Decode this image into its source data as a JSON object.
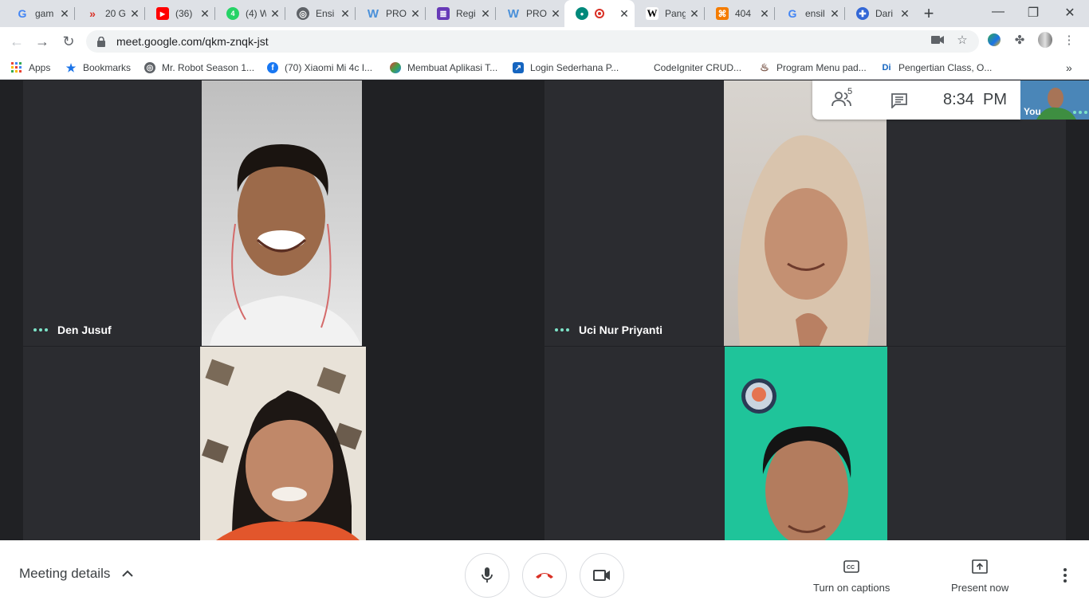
{
  "browser": {
    "tabs": [
      {
        "title": "gam",
        "favicon": "google-g-icon",
        "color": "#4285f4"
      },
      {
        "title": "20 G",
        "favicon": "chevron-logo-icon",
        "color": "#d93025"
      },
      {
        "title": "(36)",
        "favicon": "youtube-icon",
        "color": "#ff0000"
      },
      {
        "title": "(4) W",
        "favicon": "whatsapp-icon",
        "color": "#25d366"
      },
      {
        "title": "Ensi",
        "favicon": "globe-icon",
        "color": "#5f6368"
      },
      {
        "title": "PRO",
        "favicon": "word-w-icon",
        "color": "#4a90d9"
      },
      {
        "title": "Regi",
        "favicon": "forms-icon",
        "color": "#673ab7"
      },
      {
        "title": "PRO",
        "favicon": "word-w-icon",
        "color": "#4a90d9"
      },
      {
        "title": "",
        "favicon": "meet-icon",
        "color": "#00897b"
      },
      {
        "title": "Pang",
        "favicon": "wikipedia-w-icon",
        "color": "#000000"
      },
      {
        "title": "404",
        "favicon": "box-icon",
        "color": "#f57c00"
      },
      {
        "title": "ensil",
        "favicon": "google-g-icon",
        "color": "#4285f4"
      },
      {
        "title": "Dari",
        "favicon": "translate-icon",
        "color": "#3367d6"
      }
    ],
    "url": "meet.google.com/qkm-znqk-jst",
    "bookmarks": [
      {
        "label": "Apps"
      },
      {
        "label": "Bookmarks"
      },
      {
        "label": "Mr. Robot Season 1..."
      },
      {
        "label": "(70) Xiaomi Mi 4c I..."
      },
      {
        "label": "Membuat Aplikasi T..."
      },
      {
        "label": "Login Sederhana P..."
      },
      {
        "label": "CodeIgniter CRUD..."
      },
      {
        "label": "Program Menu pad..."
      },
      {
        "label": "Pengertian Class, O..."
      }
    ],
    "bookmarks_overflow": "»"
  },
  "meet": {
    "participant_count": "5",
    "time": "8:34  PM",
    "self_label": "You",
    "participants": [
      {
        "name": "Den Jusuf"
      },
      {
        "name": "Uci Nur Priyanti"
      },
      {
        "name": ""
      },
      {
        "name": ""
      }
    ],
    "controls": {
      "meeting_details": "Meeting details",
      "captions": "Turn on captions",
      "present": "Present now"
    }
  }
}
